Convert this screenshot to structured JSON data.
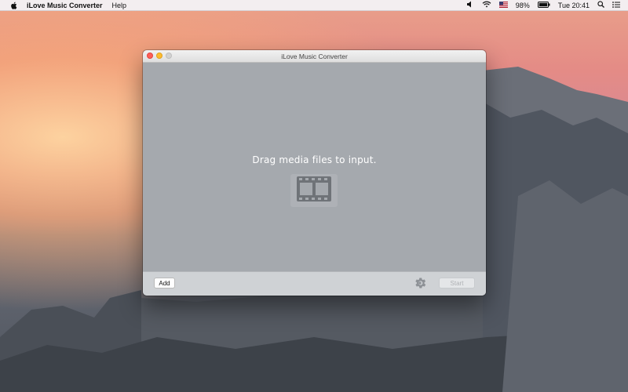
{
  "menubar": {
    "app_name": "iLove Music Converter",
    "menus": [
      "Help"
    ],
    "status": {
      "battery": "98%",
      "time": "Tue 20:41"
    }
  },
  "window": {
    "title": "iLove Music Converter",
    "drop_prompt": "Drag media files to input.",
    "add_label": "Add",
    "start_label": "Start"
  },
  "colors": {
    "close": "#ff5f57",
    "minimize": "#febc2e",
    "zoom_disabled": "#d2d2d2",
    "dropzone_bg": "#a5a9ae"
  },
  "icons": [
    "apple-icon",
    "volume-icon",
    "wifi-icon",
    "flag-icon",
    "battery-icon",
    "spotlight-icon",
    "notification-center-icon",
    "film-icon",
    "gear-icon"
  ]
}
